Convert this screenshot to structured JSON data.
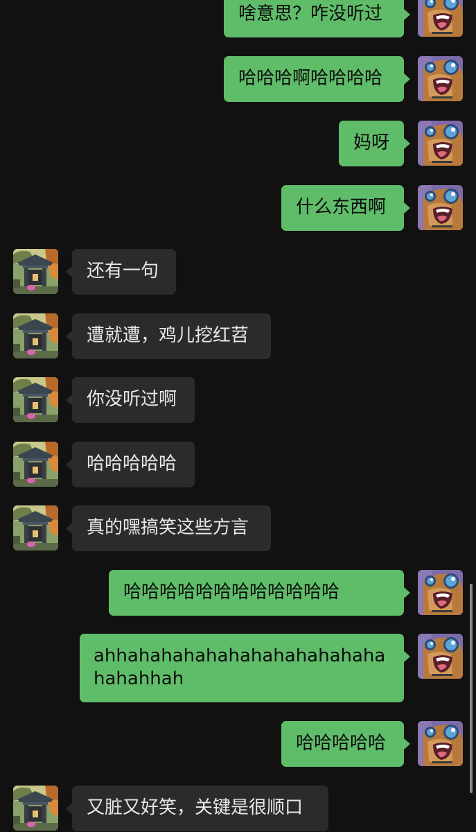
{
  "chat": {
    "messages": [
      {
        "side": "right",
        "avatar": "cartoon-character-avatar",
        "text": "啥意思？咋没听过"
      },
      {
        "side": "right",
        "avatar": "cartoon-character-avatar",
        "text": "哈哈哈啊哈哈哈哈"
      },
      {
        "side": "right",
        "avatar": "cartoon-character-avatar",
        "text": "妈呀"
      },
      {
        "side": "right",
        "avatar": "cartoon-character-avatar",
        "text": "什么东西啊"
      },
      {
        "side": "left",
        "avatar": "temple-gate-photo-avatar",
        "text": "还有一句"
      },
      {
        "side": "left",
        "avatar": "temple-gate-photo-avatar",
        "text": "遭就遭，鸡儿挖红苕"
      },
      {
        "side": "left",
        "avatar": "temple-gate-photo-avatar",
        "text": "你没听过啊"
      },
      {
        "side": "left",
        "avatar": "temple-gate-photo-avatar",
        "text": "哈哈哈哈哈"
      },
      {
        "side": "left",
        "avatar": "temple-gate-photo-avatar",
        "text": "真的嘿搞笑这些方言"
      },
      {
        "side": "right",
        "avatar": "cartoon-character-avatar",
        "text": "哈哈哈哈哈哈哈哈哈哈哈哈"
      },
      {
        "side": "right",
        "avatar": "cartoon-character-avatar",
        "text": "ahhahahahahahahahahahahahahahahhah"
      },
      {
        "side": "right",
        "avatar": "cartoon-character-avatar",
        "text": "哈哈哈哈哈"
      },
      {
        "side": "left",
        "avatar": "temple-gate-photo-avatar",
        "text": "又脏又好笑，关键是很顺口"
      }
    ]
  },
  "colors": {
    "background": "#111111",
    "sent_bubble": "#5fbd6a",
    "received_bubble": "#2b2b2b",
    "sent_text": "#0c0c0c",
    "received_text": "#e8e8e8"
  }
}
